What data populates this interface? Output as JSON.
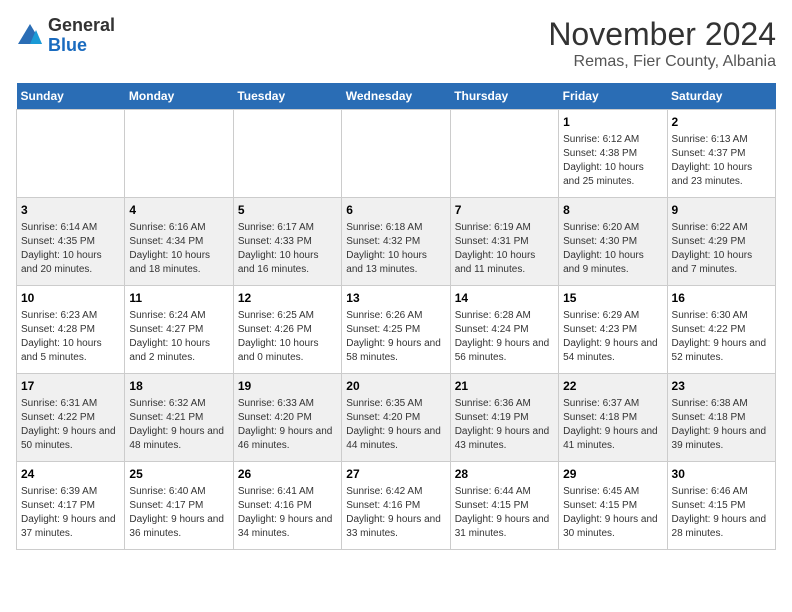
{
  "logo": {
    "general": "General",
    "blue": "Blue"
  },
  "title": "November 2024",
  "subtitle": "Remas, Fier County, Albania",
  "days_of_week": [
    "Sunday",
    "Monday",
    "Tuesday",
    "Wednesday",
    "Thursday",
    "Friday",
    "Saturday"
  ],
  "weeks": [
    [
      {
        "day": "",
        "text": ""
      },
      {
        "day": "",
        "text": ""
      },
      {
        "day": "",
        "text": ""
      },
      {
        "day": "",
        "text": ""
      },
      {
        "day": "",
        "text": ""
      },
      {
        "day": "1",
        "text": "Sunrise: 6:12 AM\nSunset: 4:38 PM\nDaylight: 10 hours and 25 minutes."
      },
      {
        "day": "2",
        "text": "Sunrise: 6:13 AM\nSunset: 4:37 PM\nDaylight: 10 hours and 23 minutes."
      }
    ],
    [
      {
        "day": "3",
        "text": "Sunrise: 6:14 AM\nSunset: 4:35 PM\nDaylight: 10 hours and 20 minutes."
      },
      {
        "day": "4",
        "text": "Sunrise: 6:16 AM\nSunset: 4:34 PM\nDaylight: 10 hours and 18 minutes."
      },
      {
        "day": "5",
        "text": "Sunrise: 6:17 AM\nSunset: 4:33 PM\nDaylight: 10 hours and 16 minutes."
      },
      {
        "day": "6",
        "text": "Sunrise: 6:18 AM\nSunset: 4:32 PM\nDaylight: 10 hours and 13 minutes."
      },
      {
        "day": "7",
        "text": "Sunrise: 6:19 AM\nSunset: 4:31 PM\nDaylight: 10 hours and 11 minutes."
      },
      {
        "day": "8",
        "text": "Sunrise: 6:20 AM\nSunset: 4:30 PM\nDaylight: 10 hours and 9 minutes."
      },
      {
        "day": "9",
        "text": "Sunrise: 6:22 AM\nSunset: 4:29 PM\nDaylight: 10 hours and 7 minutes."
      }
    ],
    [
      {
        "day": "10",
        "text": "Sunrise: 6:23 AM\nSunset: 4:28 PM\nDaylight: 10 hours and 5 minutes."
      },
      {
        "day": "11",
        "text": "Sunrise: 6:24 AM\nSunset: 4:27 PM\nDaylight: 10 hours and 2 minutes."
      },
      {
        "day": "12",
        "text": "Sunrise: 6:25 AM\nSunset: 4:26 PM\nDaylight: 10 hours and 0 minutes."
      },
      {
        "day": "13",
        "text": "Sunrise: 6:26 AM\nSunset: 4:25 PM\nDaylight: 9 hours and 58 minutes."
      },
      {
        "day": "14",
        "text": "Sunrise: 6:28 AM\nSunset: 4:24 PM\nDaylight: 9 hours and 56 minutes."
      },
      {
        "day": "15",
        "text": "Sunrise: 6:29 AM\nSunset: 4:23 PM\nDaylight: 9 hours and 54 minutes."
      },
      {
        "day": "16",
        "text": "Sunrise: 6:30 AM\nSunset: 4:22 PM\nDaylight: 9 hours and 52 minutes."
      }
    ],
    [
      {
        "day": "17",
        "text": "Sunrise: 6:31 AM\nSunset: 4:22 PM\nDaylight: 9 hours and 50 minutes."
      },
      {
        "day": "18",
        "text": "Sunrise: 6:32 AM\nSunset: 4:21 PM\nDaylight: 9 hours and 48 minutes."
      },
      {
        "day": "19",
        "text": "Sunrise: 6:33 AM\nSunset: 4:20 PM\nDaylight: 9 hours and 46 minutes."
      },
      {
        "day": "20",
        "text": "Sunrise: 6:35 AM\nSunset: 4:20 PM\nDaylight: 9 hours and 44 minutes."
      },
      {
        "day": "21",
        "text": "Sunrise: 6:36 AM\nSunset: 4:19 PM\nDaylight: 9 hours and 43 minutes."
      },
      {
        "day": "22",
        "text": "Sunrise: 6:37 AM\nSunset: 4:18 PM\nDaylight: 9 hours and 41 minutes."
      },
      {
        "day": "23",
        "text": "Sunrise: 6:38 AM\nSunset: 4:18 PM\nDaylight: 9 hours and 39 minutes."
      }
    ],
    [
      {
        "day": "24",
        "text": "Sunrise: 6:39 AM\nSunset: 4:17 PM\nDaylight: 9 hours and 37 minutes."
      },
      {
        "day": "25",
        "text": "Sunrise: 6:40 AM\nSunset: 4:17 PM\nDaylight: 9 hours and 36 minutes."
      },
      {
        "day": "26",
        "text": "Sunrise: 6:41 AM\nSunset: 4:16 PM\nDaylight: 9 hours and 34 minutes."
      },
      {
        "day": "27",
        "text": "Sunrise: 6:42 AM\nSunset: 4:16 PM\nDaylight: 9 hours and 33 minutes."
      },
      {
        "day": "28",
        "text": "Sunrise: 6:44 AM\nSunset: 4:15 PM\nDaylight: 9 hours and 31 minutes."
      },
      {
        "day": "29",
        "text": "Sunrise: 6:45 AM\nSunset: 4:15 PM\nDaylight: 9 hours and 30 minutes."
      },
      {
        "day": "30",
        "text": "Sunrise: 6:46 AM\nSunset: 4:15 PM\nDaylight: 9 hours and 28 minutes."
      }
    ]
  ]
}
